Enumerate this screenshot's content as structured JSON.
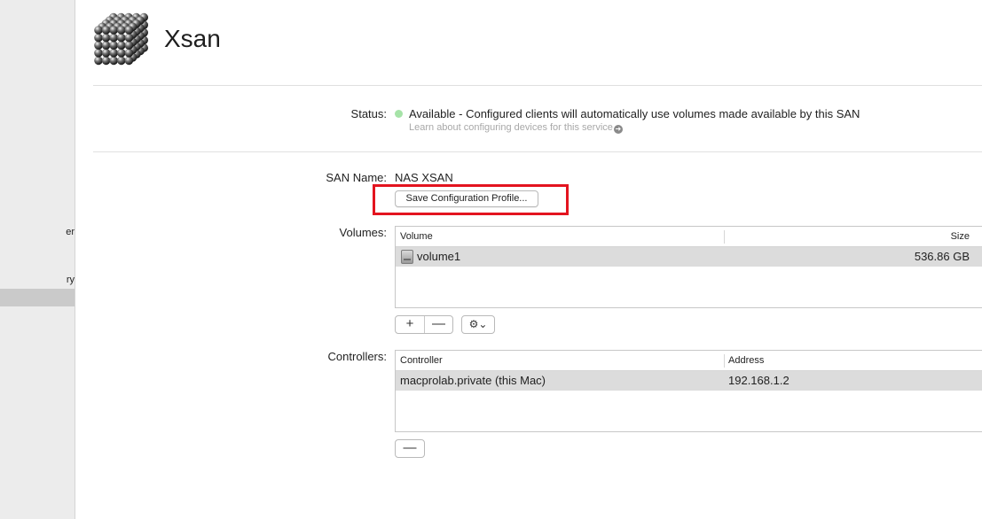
{
  "sidebar": {
    "items": [
      {
        "label": "er"
      },
      {
        "label": "ry"
      },
      {
        "label": ""
      }
    ]
  },
  "header": {
    "title": "Xsan",
    "icon": "cube-of-spheres-icon"
  },
  "status": {
    "label": "Status:",
    "text": "Available - Configured clients will automatically use volumes made available by this SAN",
    "link": "Learn about configuring devices for this service",
    "dot_color": "#a6e3a8"
  },
  "san": {
    "label": "SAN Name:",
    "value": "NAS XSAN",
    "save_button": "Save Configuration Profile..."
  },
  "volumes": {
    "label": "Volumes:",
    "columns": [
      "Volume",
      "Size"
    ],
    "rows": [
      {
        "volume": "volume1",
        "size": "536.86 GB"
      }
    ],
    "add_button": "+",
    "remove_button": "—",
    "action_button": "⚙⌄"
  },
  "controllers": {
    "label": "Controllers:",
    "columns": [
      "Controller",
      "Address"
    ],
    "rows": [
      {
        "controller": "macprolab.private (this Mac)",
        "address": "192.168.1.2"
      }
    ],
    "remove_button": "—"
  },
  "colors": {
    "highlight": "#e3141f"
  }
}
